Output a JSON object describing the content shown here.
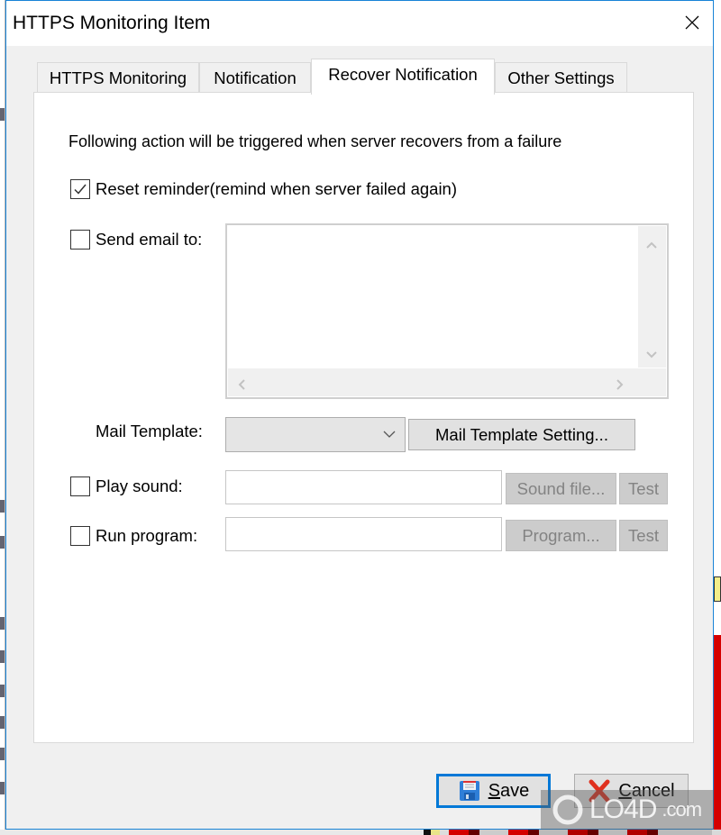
{
  "window": {
    "title": "HTTPS Monitoring Item",
    "close_icon": "close-icon"
  },
  "tabs": [
    {
      "label": "HTTPS Monitoring",
      "active": false
    },
    {
      "label": "Notification",
      "active": false
    },
    {
      "label": "Recover Notification",
      "active": true
    },
    {
      "label": "Other Settings",
      "active": false
    }
  ],
  "panel": {
    "description": "Following action will be triggered when server recovers from a failure",
    "reset_reminder": {
      "label": "Reset reminder(remind when server failed again)",
      "checked": true
    },
    "send_email": {
      "label": "Send email to:",
      "checked": false,
      "value": ""
    },
    "mail_template": {
      "label": "Mail Template:",
      "selected": "",
      "setting_button": "Mail Template Setting..."
    },
    "play_sound": {
      "label": "Play sound:",
      "checked": false,
      "value": "",
      "file_button": "Sound file...",
      "test_button": "Test"
    },
    "run_program": {
      "label": "Run program:",
      "checked": false,
      "value": "",
      "program_button": "Program...",
      "test_button": "Test"
    }
  },
  "footer": {
    "save_label": "Save",
    "save_mnemonic": "S",
    "save_rest": "ave",
    "cancel_label": "Cancel",
    "cancel_mnemonic": "C",
    "cancel_rest": "ancel"
  },
  "watermark": {
    "brand": "LO4D",
    "suffix": ".com"
  },
  "colors": {
    "accent": "#0078d7",
    "window_border": "#1883d7",
    "disabled_text": "#838383",
    "cancel_icon": "#e0301e",
    "save_icon": "#2f7fd8"
  }
}
